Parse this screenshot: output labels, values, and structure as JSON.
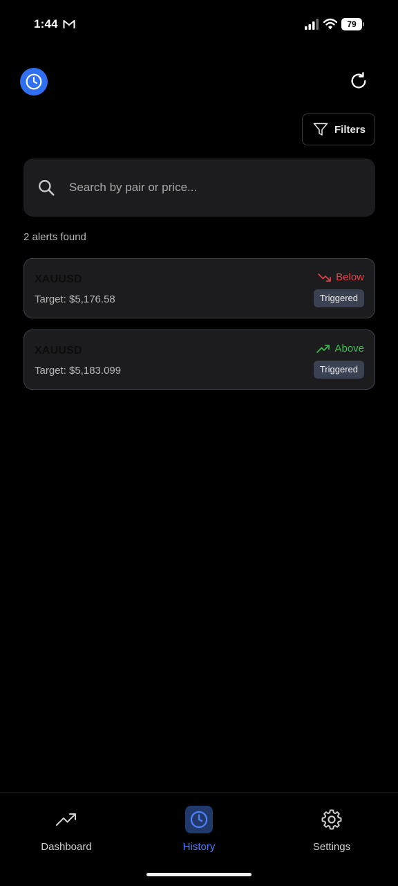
{
  "status_bar": {
    "time": "1:44",
    "battery": "79",
    "icons": [
      "gmail-icon",
      "signal-icon",
      "wifi-icon",
      "battery-icon"
    ]
  },
  "header": {
    "badge_icon": "clock-icon",
    "refresh_icon": "refresh-icon",
    "filters_label": "Filters",
    "filters_icon": "funnel-icon"
  },
  "search": {
    "placeholder": "Search by pair or price...",
    "value": ""
  },
  "results": {
    "count_text": "2 alerts found"
  },
  "alerts": [
    {
      "pair": "XAUUSD",
      "target": "Target: $5,176.58",
      "direction": "Below",
      "direction_icon": "trending-down-icon",
      "status": "Triggered"
    },
    {
      "pair": "XAUUSD",
      "target": "Target: $5,183.099",
      "direction": "Above",
      "direction_icon": "trending-up-icon",
      "status": "Triggered"
    }
  ],
  "nav": {
    "items": [
      {
        "label": "Dashboard",
        "icon": "trending-up-icon",
        "active": false
      },
      {
        "label": "History",
        "icon": "clock-icon",
        "active": true
      },
      {
        "label": "Settings",
        "icon": "gear-icon",
        "active": false
      }
    ]
  },
  "colors": {
    "background": "#000000",
    "card": "#1c1c1e",
    "accent": "#2f6ff0",
    "below": "#e0454b",
    "above": "#3fbf55",
    "pill": "#3a4252"
  }
}
